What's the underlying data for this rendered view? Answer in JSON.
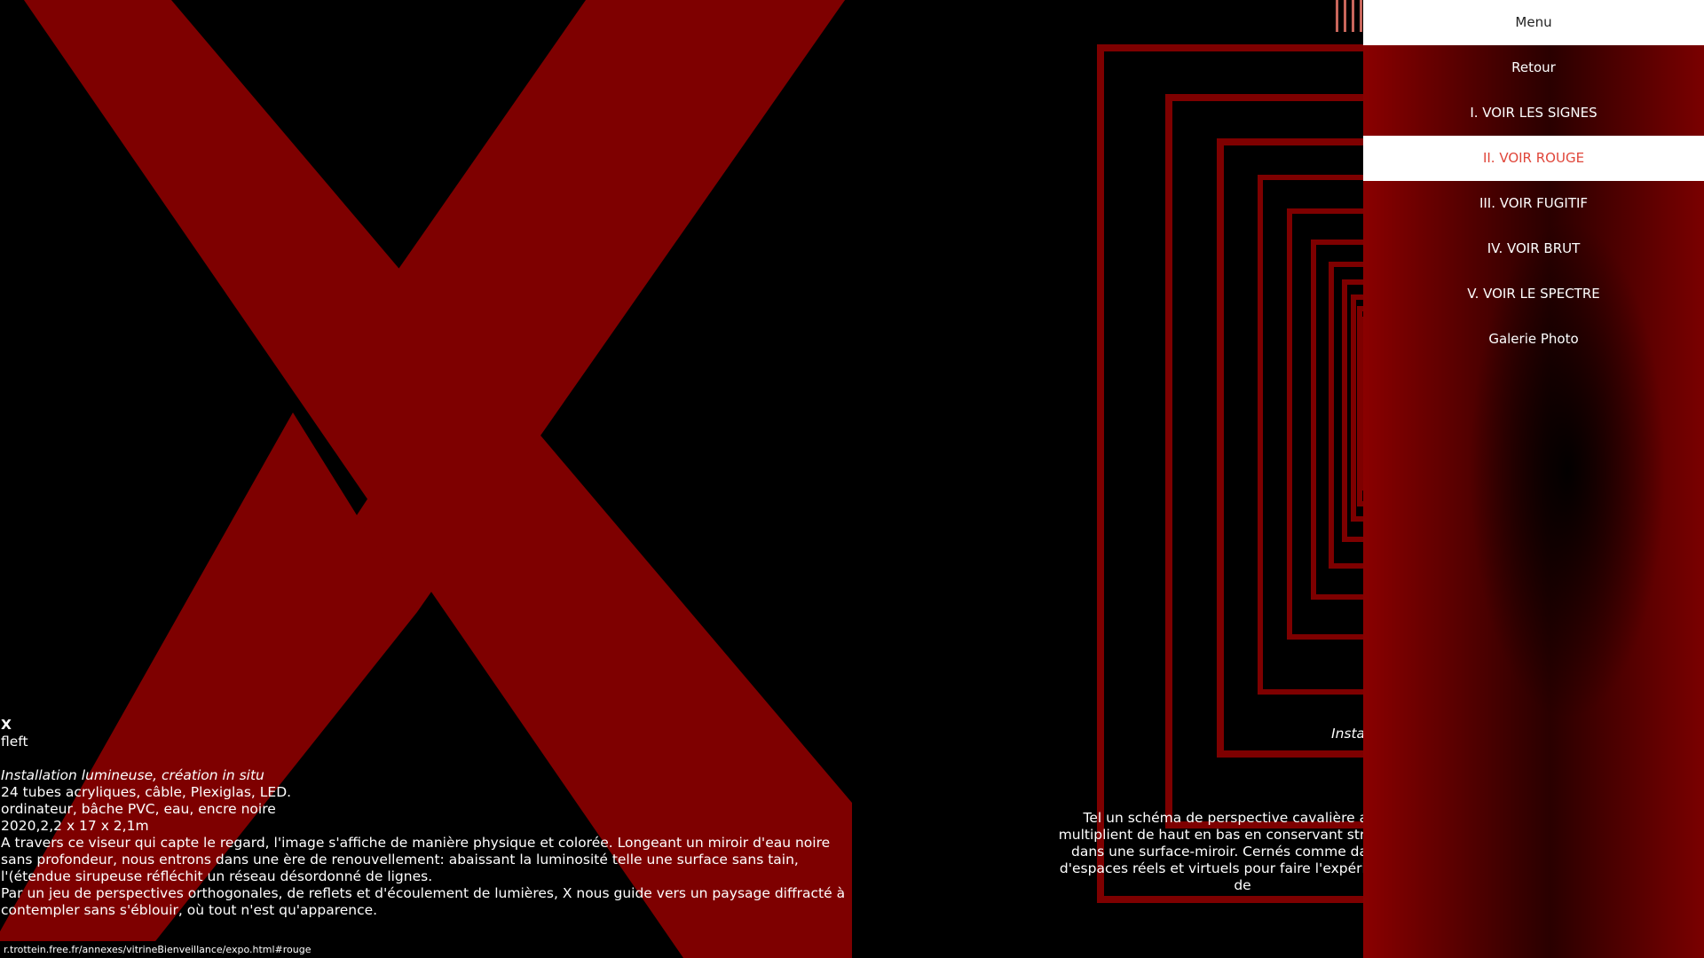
{
  "menu": {
    "header": "Menu",
    "items": [
      {
        "label": "Retour"
      },
      {
        "label": "I. VOIR LES SIGNES"
      },
      {
        "label": "II. VOIR ROUGE",
        "active": true
      },
      {
        "label": "III. VOIR FUGITIF"
      },
      {
        "label": "IV. VOIR BRUT"
      },
      {
        "label": "V. VOIR LE SPECTRE"
      },
      {
        "label": "Galerie Photo"
      }
    ]
  },
  "artwork_left": {
    "title": "X",
    "subtitle": "fleft",
    "kind": "Installation lumineuse, création in situ",
    "materials_1": "24 tubes acryliques, câble, Plexiglas, LED.",
    "materials_2": "ordinateur, bâche PVC, eau, encre noire",
    "year_dims": "2020,2,2 x 17 x 2,1m",
    "description_1": "A travers ce viseur qui capte le regard, l'image s'affiche de manière physique et colorée. Longeant un miroir d'eau noire sans profondeur, nous entrons dans une ère de renouvellement: abaissant la luminosité telle une surface sans tain, l'(étendue sirupeuse réfléchit un réseau désordonné de lignes.",
    "description_2": "Par un jeu de perspectives orthogonales, de reflets et d'écoulement de lumières, X nous guide vers un paysage diffracté à contempler sans s'éblouir, où tout n'est qu'apparence."
  },
  "artwork_right": {
    "kind": "Insta",
    "line_1": "Tel un schéma de perspective cavalière au poi",
    "line_2": "multiplient de haut en bas en conservant strictement",
    "line_3": "dans une surface-miroir. Cernés comme dans une",
    "line_4": "d'espaces réels et virtuels pour faire l'expérience mu",
    "line_5": "de"
  },
  "status_url": "r.trottein.free.fr/annexes/vitrineBienveillance/expo.html#rouge",
  "colors": {
    "accent_red": "#7e0000",
    "active_text": "#e0463a",
    "panel_white": "#ffffff"
  }
}
